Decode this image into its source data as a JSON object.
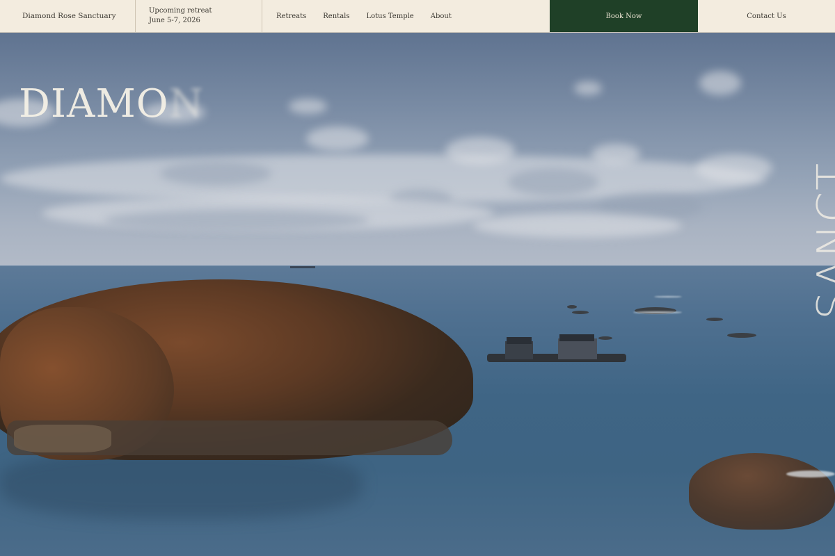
{
  "nav": {
    "brand": "Diamond Rose Sanctuary",
    "retreat_line1": "Upcoming retreat",
    "retreat_line2": "June 5-7, 2026",
    "links": [
      "Retreats",
      "Rentals",
      "Lotus Temple",
      "About"
    ],
    "book_label": "Book Now",
    "contact_label": "Contact Us"
  },
  "hero": {
    "headline_visible": "DIAMO",
    "headline_fading": "N",
    "vertical_visible": "SANCT"
  },
  "colors": {
    "nav_bg": "#f3ecdf",
    "book_bg": "#1f4027",
    "book_text": "#e9e2d0"
  }
}
